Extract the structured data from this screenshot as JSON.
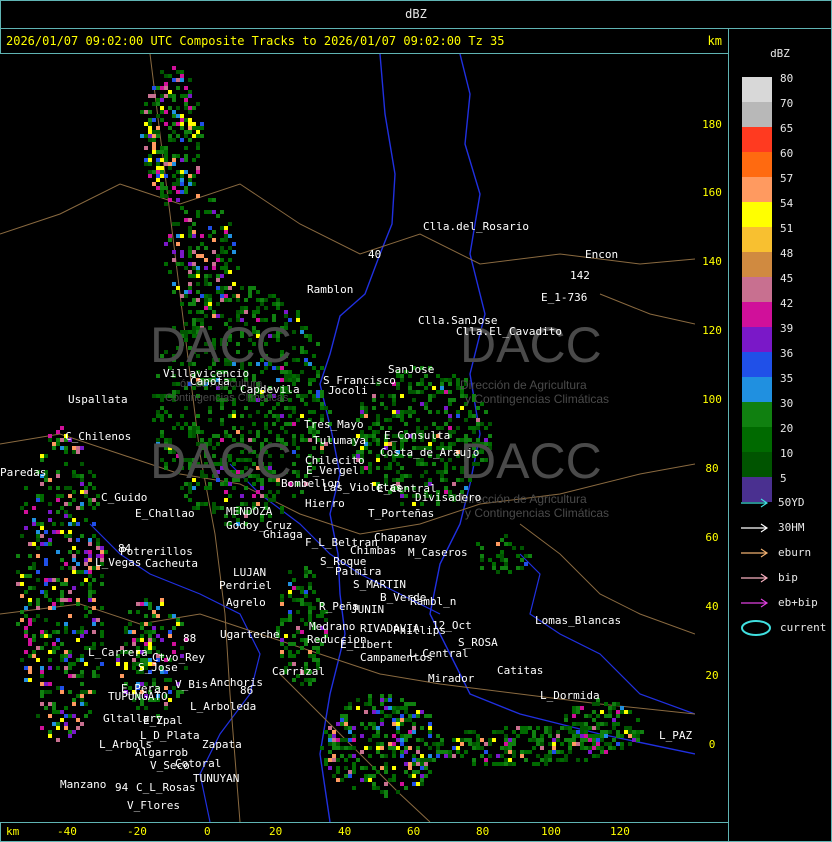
{
  "window": {
    "title": "dBZ"
  },
  "header": {
    "title": "2026/01/07 09:02:00 UTC Composite Tracks to 2026/01/07 09:02:00 Tz 35",
    "unit": "km"
  },
  "axes": {
    "y_ticks": [
      "180",
      "160",
      "140",
      "120",
      "100",
      "80",
      "60",
      "40",
      "20",
      "0"
    ],
    "x_ticks": [
      "-40",
      "-20",
      "0",
      "20",
      "40",
      "60",
      "80",
      "100",
      "120"
    ],
    "x_unit": "km"
  },
  "legend": {
    "title": "dBZ",
    "scale": [
      {
        "value": "80",
        "color": "#d8d8d8"
      },
      {
        "value": "70",
        "color": "#b8b8b8"
      },
      {
        "value": "65",
        "color": "#ff3a20"
      },
      {
        "value": "60",
        "color": "#ff6a10"
      },
      {
        "value": "57",
        "color": "#ff9a60"
      },
      {
        "value": "54",
        "color": "#ffff00"
      },
      {
        "value": "51",
        "color": "#f8c030"
      },
      {
        "value": "48",
        "color": "#d08a40"
      },
      {
        "value": "45",
        "color": "#c87090"
      },
      {
        "value": "42",
        "color": "#d0109a"
      },
      {
        "value": "39",
        "color": "#7a18c8"
      },
      {
        "value": "36",
        "color": "#2050e8"
      },
      {
        "value": "35",
        "color": "#2090e0"
      },
      {
        "value": "30",
        "color": "#108010"
      },
      {
        "value": "20",
        "color": "#006a00"
      },
      {
        "value": "10",
        "color": "#005400"
      },
      {
        "value": "5",
        "color": "#4a3090"
      }
    ],
    "tracks": [
      {
        "label": "50YD",
        "color": "#40e0e0"
      },
      {
        "label": "30HM",
        "color": "#ffffff"
      },
      {
        "label": "eburn",
        "color": "#f0b070"
      },
      {
        "label": "bip",
        "color": "#f8b0c0"
      },
      {
        "label": "eb+bip",
        "color": "#e040e0"
      }
    ],
    "current_label": "current",
    "current_color": "#40e0e0"
  },
  "watermark": {
    "brand": "DACC",
    "line1": "Dirección de Agricultura",
    "line2": "y Contingencias Climáticas",
    "fragment1": "ón de Agricultura",
    "fragment2": "Contingencias Climáticas"
  },
  "places": [
    "Clla.del_Rosario",
    "Encon",
    "142",
    "E_1-736",
    "Ramblon",
    "Clla.SanJose",
    "Clla.El_Cavadito",
    "Villavicencio",
    "Uspallata",
    "Canota",
    "Capdevila",
    "S_Francisco",
    "SanJose",
    "Jocoli",
    "C_Chilenos",
    "Tres_Mayo",
    "Tulumaya",
    "E_Consulta",
    "Costa_de_Araujo",
    "Chilecito",
    "E_Vergel",
    "Las_Violetas",
    "Bombellon",
    "E_Central",
    "Divisadero",
    "Paredas",
    "C_Guido",
    "E_Challao",
    "MENDOZA",
    "Godoy_Cruz",
    "Hierro",
    "T_Porteñas",
    "Ghiaga",
    "Chapanay",
    "F_L_Beltran",
    "Chimbas",
    "M_Caseros",
    "Potrerillos",
    "L_Vegas",
    "Cacheuta",
    "LUJAN",
    "S_Roque",
    "Palmira",
    "S_MARTIN",
    "Perdriel",
    "Agrelo",
    "R_Peña",
    "JUNIN",
    "B_Verde",
    "Rambl_n",
    "Ugarteche",
    "Medrano",
    "Reduccion",
    "RIVADAVIA",
    "Phillips",
    "12_Oct",
    "S_ROSA",
    "Lomas_Blancas",
    "L_Carrera",
    "Ctvo_Rey",
    "S_Jose",
    "E_Libert",
    "Campamentos",
    "L_Central",
    "Catitas",
    "Carrizal",
    "Anchoris",
    "E_Pera",
    "V_Bis",
    "TUPUNGATO",
    "L_Arboleda",
    "Mirador",
    "L_Dormida",
    "Gltallary",
    "E_Zpal",
    "L_D_Plata",
    "L_Arbols",
    "Zapata",
    "L_PAZ",
    "Algarrob",
    "V_Seco",
    "Cotoral",
    "TUNUYAN",
    "Manzano",
    "C_L_Rosas",
    "V_Flores",
    "84",
    "88",
    "94",
    "86",
    "40"
  ]
}
